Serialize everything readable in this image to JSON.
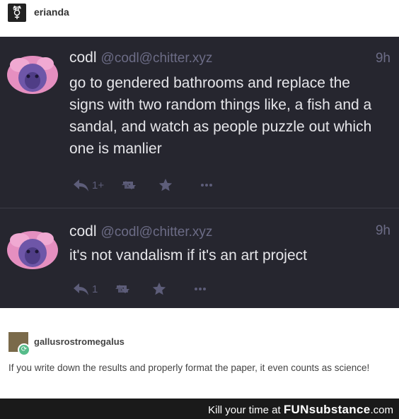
{
  "reblog_header": {
    "username": "erianda",
    "avatar_icon": "transgender-symbol-icon",
    "avatar_glyph": "⚧"
  },
  "posts": [
    {
      "name": "codl",
      "handle": "@codl@chitter.xyz",
      "time": "9h",
      "text": "go to gendered bathrooms and replace the signs with two random things like, a fish and a sandal, and watch as people puzzle out which one is manlier",
      "reply_count": "1+"
    },
    {
      "name": "codl",
      "handle": "@codl@chitter.xyz",
      "time": "9h",
      "text": "it's not vandalism if it's an art project",
      "reply_count": "1"
    }
  ],
  "comment": {
    "username": "gallusrostromegalus",
    "text": "If you write down the results and properly format the paper, it even counts as science!"
  },
  "footer": {
    "text": "Kill your time at",
    "brand": "FUNsubstance",
    "suffix": ".com"
  },
  "colors": {
    "panel_bg": "#26262f",
    "muted": "#6c6c86",
    "icon": "#5d5d79",
    "text_light": "#e6e6ea"
  }
}
